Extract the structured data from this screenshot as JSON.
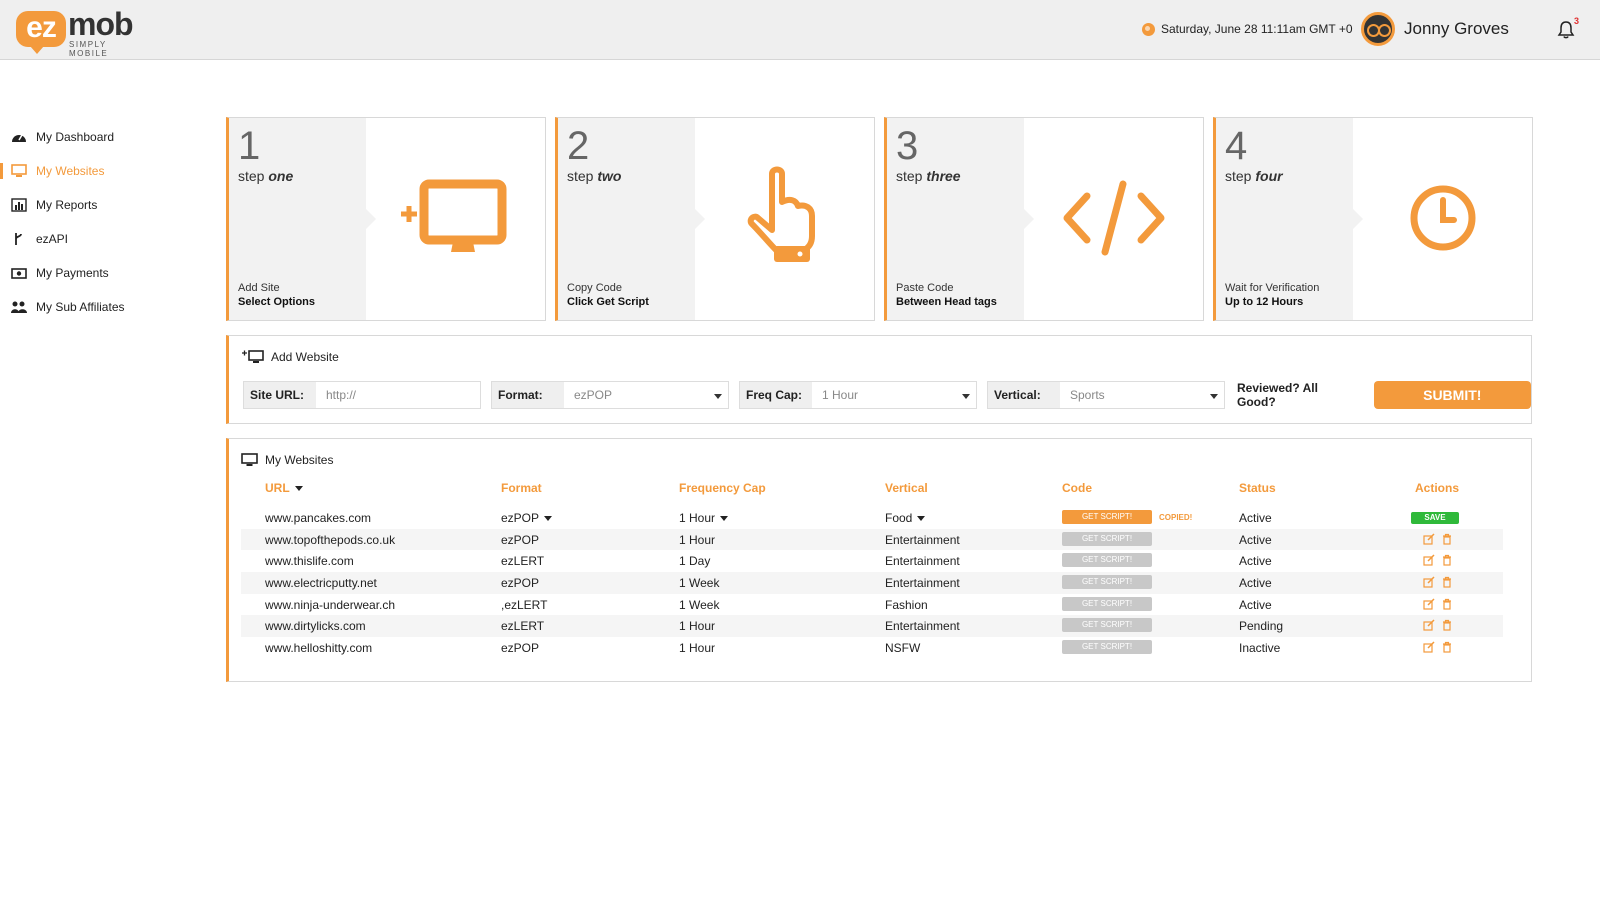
{
  "header": {
    "logo_badge": "ez",
    "logo_word": "mob",
    "logo_tagline": "SIMPLY MOBILE",
    "datetime": "Saturday, June 28 11:11am GMT +0",
    "user_name": "Jonny Groves",
    "notification_count": "3"
  },
  "sidebar": {
    "items": [
      {
        "label": "My Dashboard",
        "icon": "dashboard-icon"
      },
      {
        "label": "My Websites",
        "icon": "monitor-icon",
        "active": true
      },
      {
        "label": "My Reports",
        "icon": "bar-chart-icon"
      },
      {
        "label": "ezAPI",
        "icon": "branch-icon"
      },
      {
        "label": "My Payments",
        "icon": "money-icon"
      },
      {
        "label": "My Sub Affiliates",
        "icon": "users-icon"
      }
    ]
  },
  "steps": [
    {
      "num": "1",
      "word": "step",
      "ordinal": "one",
      "line1": "Add Site",
      "line2": "Select Options",
      "icon": "add-monitor-icon"
    },
    {
      "num": "2",
      "word": "step",
      "ordinal": "two",
      "line1": "Copy Code",
      "line2": "Click Get Script",
      "icon": "pointer-hand-icon"
    },
    {
      "num": "3",
      "word": "step",
      "ordinal": "three",
      "line1": "Paste Code",
      "line2": "Between Head tags",
      "icon": "code-icon"
    },
    {
      "num": "4",
      "word": "step",
      "ordinal": "four",
      "line1": "Wait for Verification",
      "line2": "Up to 12 Hours",
      "icon": "clock-icon"
    }
  ],
  "add_website": {
    "title": "Add Website",
    "site_url_label": "Site URL:",
    "site_url_placeholder": "http://",
    "format_label": "Format:",
    "format_value": "ezPOP",
    "freq_label": "Freq Cap:",
    "freq_value": "1 Hour",
    "vertical_label": "Vertical:",
    "vertical_value": "Sports",
    "reviewed_text": "Reviewed? All Good?",
    "submit_label": "SUBMIT!"
  },
  "my_websites": {
    "title": "My Websites",
    "columns": [
      "URL",
      "Format",
      "Frequency Cap",
      "Vertical",
      "Code",
      "Status",
      "Actions"
    ],
    "get_script_label": "GET SCRIPT!",
    "copied_label": "COPIED!",
    "save_label": "SAVE",
    "rows": [
      {
        "url": "www.pancakes.com",
        "format": "ezPOP",
        "freq": "1 Hour",
        "vertical": "Food",
        "status": "Active"
      },
      {
        "url": "www.topofthepods.co.uk",
        "format": "ezPOP",
        "freq": "1 Hour",
        "vertical": "Entertainment",
        "status": "Active"
      },
      {
        "url": "www.thislife.com",
        "format": "ezLERT",
        "freq": "1 Day",
        "vertical": "Entertainment",
        "status": "Active"
      },
      {
        "url": "www.electricputty.net",
        "format": "ezPOP",
        "freq": "1 Week",
        "vertical": "Entertainment",
        "status": "Active"
      },
      {
        "url": "www.ninja-underwear.ch",
        "format": ",ezLERT",
        "freq": "1 Week",
        "vertical": "Fashion",
        "status": "Active"
      },
      {
        "url": "www.dirtylicks.com",
        "format": "ezLERT",
        "freq": "1 Hour",
        "vertical": "Entertainment",
        "status": "Pending"
      },
      {
        "url": "www.helloshitty.com",
        "format": "ezPOP",
        "freq": "1 Hour",
        "vertical": "NSFW",
        "status": "Inactive"
      }
    ]
  },
  "colors": {
    "accent": "#f39a3c",
    "save": "#2fb93a",
    "disabled": "#c8c8c8"
  }
}
